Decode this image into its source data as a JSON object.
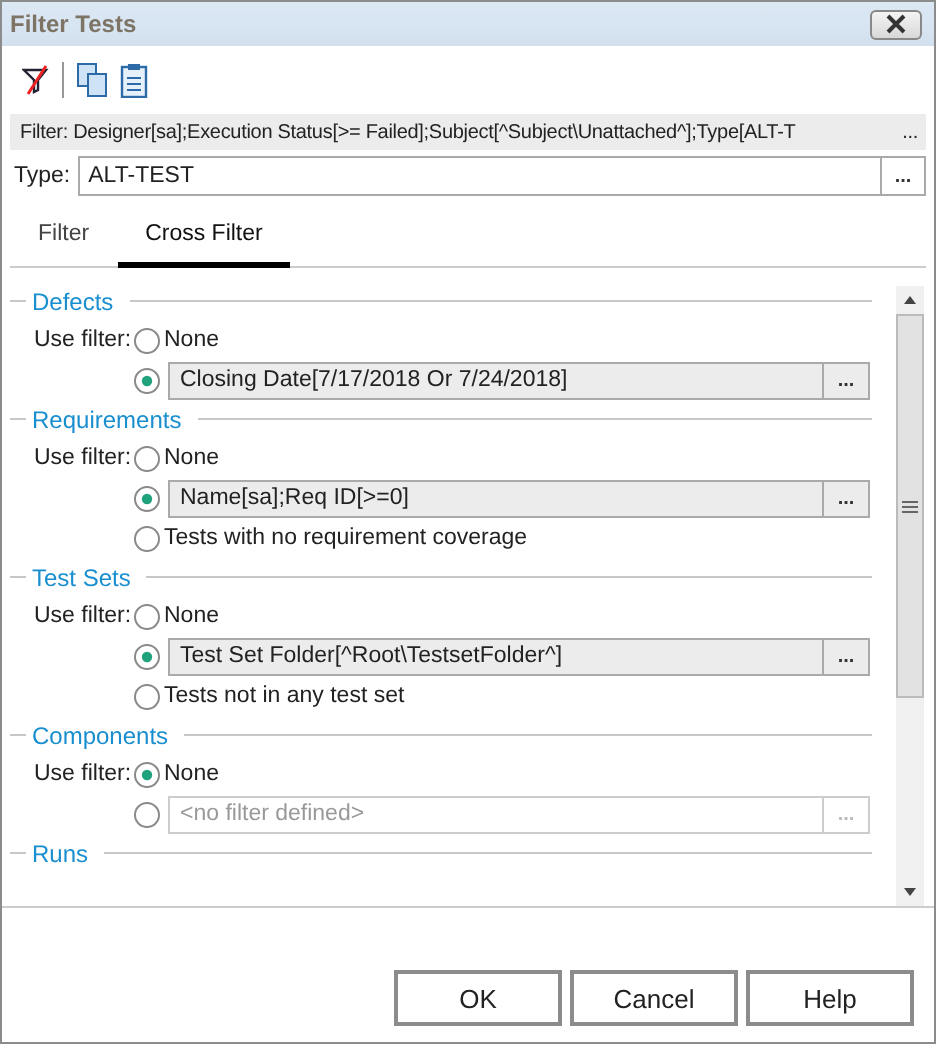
{
  "window": {
    "title": "Filter Tests"
  },
  "filter_summary": {
    "text": "Filter: Designer[sa];Execution Status[>= Failed];Subject[^Subject\\Unattached^];Type[ALT-T",
    "more": "..."
  },
  "type_field": {
    "label": "Type:",
    "value": "ALT-TEST",
    "button": "..."
  },
  "tabs": [
    {
      "label": "Filter",
      "selected": false
    },
    {
      "label": "Cross Filter",
      "selected": true
    }
  ],
  "sections": [
    {
      "title": "Defects",
      "label": "Use filter:",
      "options": [
        {
          "kind": "radio",
          "label": "None",
          "selected": false
        },
        {
          "kind": "filter",
          "value": "Closing Date[7/17/2018 Or 7/24/2018]",
          "button": "...",
          "selected": true,
          "disabled": false
        }
      ]
    },
    {
      "title": "Requirements",
      "label": "Use filter:",
      "options": [
        {
          "kind": "radio",
          "label": "None",
          "selected": false
        },
        {
          "kind": "filter",
          "value": "Name[sa];Req ID[>=0]",
          "button": "...",
          "selected": true,
          "disabled": false
        },
        {
          "kind": "radio",
          "label": "Tests with no requirement coverage",
          "selected": false
        }
      ]
    },
    {
      "title": "Test Sets",
      "label": "Use filter:",
      "options": [
        {
          "kind": "radio",
          "label": "None",
          "selected": false
        },
        {
          "kind": "filter",
          "value": "Test Set Folder[^Root\\TestsetFolder^]",
          "button": "...",
          "selected": true,
          "disabled": false
        },
        {
          "kind": "radio",
          "label": "Tests not in any test set",
          "selected": false
        }
      ]
    },
    {
      "title": "Components",
      "label": "Use filter:",
      "options": [
        {
          "kind": "radio",
          "label": "None",
          "selected": true
        },
        {
          "kind": "filter",
          "placeholder": "<no filter defined>",
          "button": "...",
          "selected": false,
          "disabled": true
        }
      ]
    },
    {
      "title": "Runs"
    }
  ],
  "buttons": [
    "OK",
    "Cancel",
    "Help"
  ]
}
